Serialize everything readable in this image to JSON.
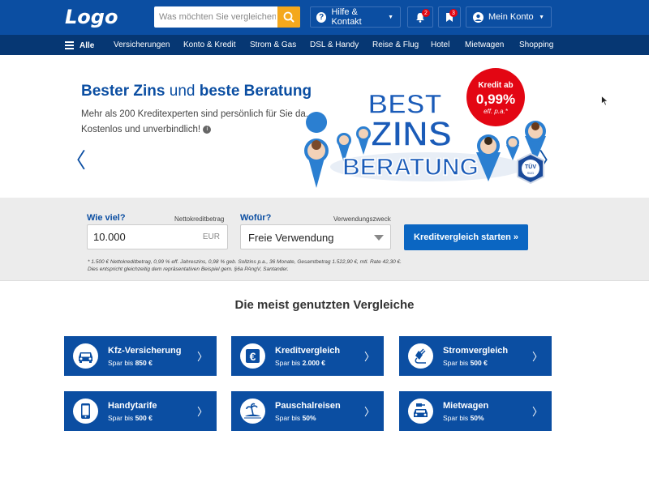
{
  "header": {
    "logo": "Logo",
    "search_placeholder": "Was möchten Sie vergleichen?",
    "help_label": "Hilfe & Kontakt",
    "notifications_count": "2",
    "notes_count": "3",
    "account_label": "Mein Konto"
  },
  "nav": {
    "all_label": "Alle",
    "items": [
      "Versicherungen",
      "Konto & Kredit",
      "Strom & Gas",
      "DSL & Handy",
      "Reise & Flug",
      "Hotel",
      "Mietwagen",
      "Shopping"
    ]
  },
  "hero": {
    "title_bold1": "Bester Zins",
    "title_mid": "und",
    "title_bold2": "beste Beratung",
    "subtitle_line1": "Mehr als 200 Kreditexperten sind persönlich für Sie da.",
    "subtitle_line2": "Kostenlos und unverbindlich!",
    "info_icon": "i",
    "badge_line1": "Kredit ab",
    "badge_rate": "0,99%",
    "badge_line3": "eff. p.a.*",
    "graphic_word1": "BEST",
    "graphic_word2": "ZINS",
    "graphic_word3": "BERATUNG",
    "seal_text": "TÜV",
    "seal_sub": "SÜD",
    "prev_arrow": "〈",
    "next_arrow": "〉",
    "colors": {
      "brand": "#0b4ea2",
      "accent": "#f4a81d",
      "badge": "#e30613"
    }
  },
  "calculator": {
    "amount_label": "Wie viel?",
    "amount_hint": "Nettokreditbetrag",
    "amount_value": "10.000",
    "amount_unit": "EUR",
    "purpose_label": "Wofür?",
    "purpose_hint": "Verwendungszweck",
    "purpose_value": "Freie Verwendung",
    "cta_label": "Kreditvergleich starten »",
    "disclaimer_line1": "* 1.500 € Nettokreditbetrag, 0,99 % eff. Jahreszins, 0,98 % geb. Sollzins p.a., 36 Monate, Gesamtbetrag 1.522,90 €, mtl. Rate 42,30 €.",
    "disclaimer_line2": "Dies entspricht gleichzeitig dem repräsentativen Beispiel gem. §6a PAngV, Santander."
  },
  "comparisons": {
    "title": "Die meist genutzten Vergleiche",
    "cards": [
      {
        "title": "Kfz-Versicherung",
        "prefix": "Spar bis",
        "amount": "850 €",
        "icon": "car-icon"
      },
      {
        "title": "Kreditvergleich",
        "prefix": "Spar bis",
        "amount": "2.000 €",
        "icon": "euro-icon"
      },
      {
        "title": "Stromvergleich",
        "prefix": "Spar bis",
        "amount": "500 €",
        "icon": "plug-icon"
      },
      {
        "title": "Handytarife",
        "prefix": "Spar bis",
        "amount": "500 €",
        "icon": "phone-icon"
      },
      {
        "title": "Pauschalreisen",
        "prefix": "Spar bis",
        "amount": "50%",
        "icon": "island-icon"
      },
      {
        "title": "Mietwagen",
        "prefix": "Spar bis",
        "amount": "50%",
        "icon": "rental-car-icon"
      }
    ],
    "arrow": "〉"
  }
}
